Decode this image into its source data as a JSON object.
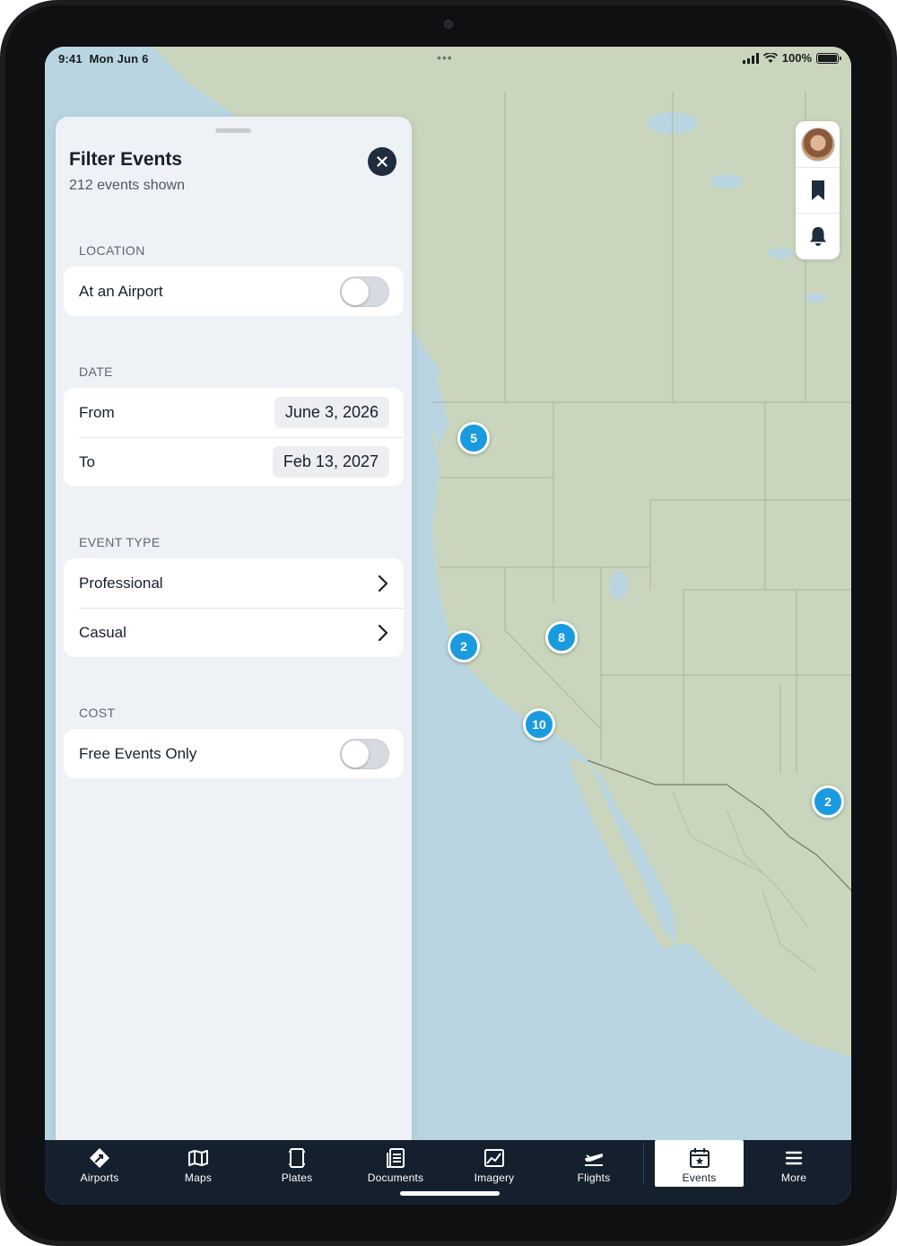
{
  "status_bar": {
    "time": "9:41",
    "date": "Mon Jun 6",
    "battery": "100%"
  },
  "filter_panel": {
    "title": "Filter Events",
    "subtitle": "212 events shown",
    "location": {
      "header": "LOCATION",
      "at_airport_label": "At an Airport",
      "at_airport_on": false
    },
    "date": {
      "header": "DATE",
      "from_label": "From",
      "from_value": "June 3, 2026",
      "to_label": "To",
      "to_value": "Feb 13, 2027"
    },
    "event_type": {
      "header": "EVENT TYPE",
      "options": [
        "Professional",
        "Casual"
      ]
    },
    "cost": {
      "header": "COST",
      "free_only_label": "Free Events Only",
      "free_only_on": false
    }
  },
  "map": {
    "land_color": "#c9d6bd",
    "water_color": "#b9d5e2",
    "marker_color": "#1a9be0",
    "clusters": [
      {
        "count": "5"
      },
      {
        "count": "2"
      },
      {
        "count": "8"
      },
      {
        "count": "10"
      },
      {
        "count": "2"
      }
    ]
  },
  "toolbar": {
    "icons": [
      "avatar",
      "bookmark-icon",
      "bell-icon"
    ]
  },
  "tab_bar": {
    "active": "Events",
    "tabs": [
      {
        "label": "Airports",
        "icon": "airports-icon"
      },
      {
        "label": "Maps",
        "icon": "maps-icon"
      },
      {
        "label": "Plates",
        "icon": "plates-icon"
      },
      {
        "label": "Documents",
        "icon": "documents-icon"
      },
      {
        "label": "Imagery",
        "icon": "imagery-icon"
      },
      {
        "label": "Flights",
        "icon": "flights-icon"
      },
      {
        "label": "Events",
        "icon": "events-icon"
      },
      {
        "label": "More",
        "icon": "more-icon"
      }
    ]
  }
}
